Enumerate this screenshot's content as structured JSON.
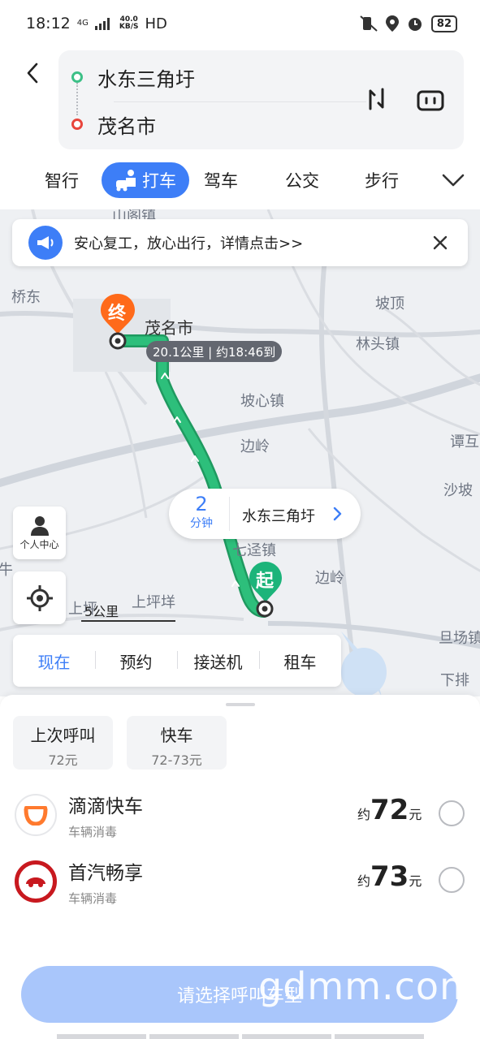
{
  "status": {
    "time": "18:12",
    "network": "4G",
    "speed_value": "40.0",
    "speed_unit": "KB/S",
    "hd": "HD",
    "battery": "82"
  },
  "route": {
    "from": "水东三角圩",
    "to": "茂名市"
  },
  "modes": [
    "智行",
    "打车",
    "驾车",
    "公交",
    "步行"
  ],
  "notice": {
    "text": "安心复工，放心出行，详情点击>>"
  },
  "map": {
    "labels": [
      "山阁镇",
      "桥东",
      "坡顶",
      "林头镇",
      "坡心镇",
      "边岭",
      "谭互",
      "沙坡",
      "七迳镇",
      "边岭",
      "上坪",
      "上坪垟",
      "旦场镇",
      "下排",
      "牛"
    ],
    "end_pin": "终",
    "start_pin": "起",
    "city": "茂名市",
    "distance_pill": "20.1公里 | 约18:46到",
    "eta": {
      "minutes": "2",
      "unit": "分钟",
      "place": "水东三角圩"
    },
    "personal_center": "个人中心",
    "scale": "5公里"
  },
  "time_tabs": [
    "现在",
    "预约",
    "接送机",
    "租车"
  ],
  "quick": [
    {
      "title": "上次呼叫",
      "price": "72元"
    },
    {
      "title": "快车",
      "price": "72-73元"
    }
  ],
  "cars": [
    {
      "name": "滴滴快车",
      "tag": "车辆消毒",
      "approx": "约",
      "price": "72",
      "unit": "元"
    },
    {
      "name": "首汽畅享",
      "tag": "车辆消毒",
      "approx": "约",
      "price": "73",
      "unit": "元"
    }
  ],
  "submit": "请选择呼叫车型",
  "watermark": "gdmm.com",
  "colors": {
    "accent": "#3d7ef7",
    "route_green": "#1faa6b",
    "end_orange": "#ff6a1a",
    "start_green": "#1cb47a"
  }
}
